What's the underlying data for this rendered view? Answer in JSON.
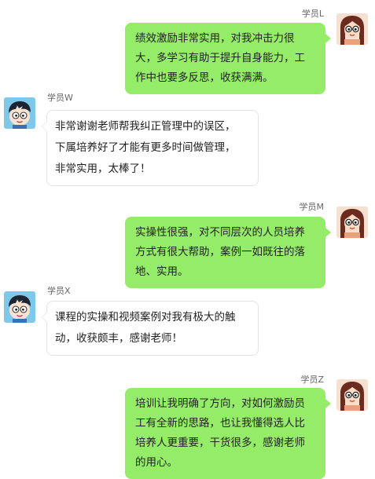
{
  "chat": {
    "messages": [
      {
        "sender": "学员L",
        "side": "right",
        "avatar_icon": "girl-avatar-icon",
        "lines": [
          "绩效激励非常实用，对我冲击力很",
          "大，多学习有助于提升自身能力，工",
          "作中也要多反思，收获满满。"
        ]
      },
      {
        "sender": "学员W",
        "side": "left",
        "avatar_icon": "boy-avatar-icon",
        "lines": [
          "非常谢谢老师帮我纠正管理中的误区，",
          "下属培养好了才能有更多时间做管理，",
          "非常实用，太棒了！"
        ]
      },
      {
        "sender": "学员M",
        "side": "right",
        "avatar_icon": "girl-avatar-icon",
        "lines": [
          "实操性很强，对不同层次的人员培养",
          "方式有很大帮助，案例一如既往的落",
          "地、实用。"
        ]
      },
      {
        "sender": "学员X",
        "side": "left",
        "avatar_icon": "boy-avatar-icon",
        "lines": [
          "课程的实操和视频案例对我有极大的触",
          "动，收获颇丰，感谢老师！"
        ]
      },
      {
        "sender": "学员Z",
        "side": "right",
        "avatar_icon": "girl-avatar-icon",
        "lines": [
          "培训让我明确了方向，对如何激励员",
          "工有全新的思路，也让我懂得选人比",
          "培养人更重要，干货很多，感谢老师",
          "的用心。"
        ]
      }
    ]
  },
  "colors": {
    "right_bubble": "#95ec69",
    "left_bubble": "#ffffff",
    "left_bubble_border": "#e3e3e3",
    "name_text": "#666666"
  }
}
